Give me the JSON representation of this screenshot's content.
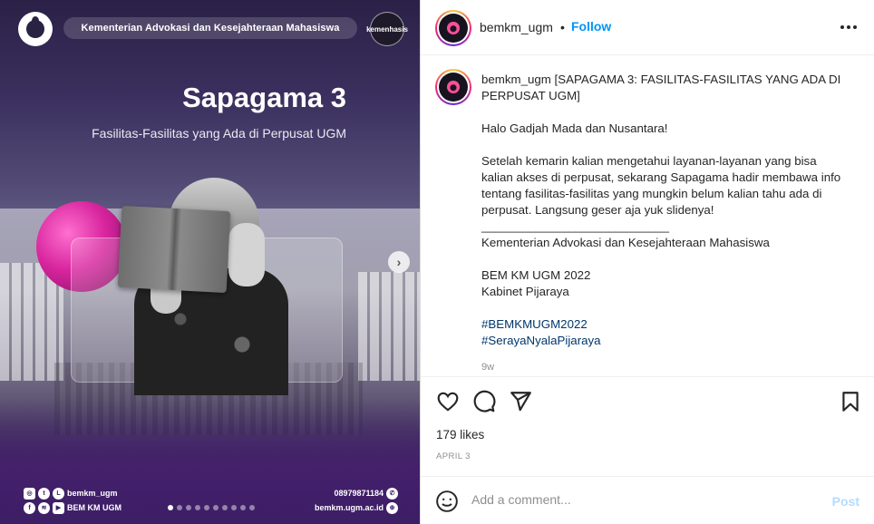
{
  "media": {
    "banner_text": "Kementerian Advokasi dan Kesejahteraan Mahasiswa",
    "right_logo_text": "kemenhasis",
    "title": "Sapagama 3",
    "subtitle": "Fasilitas-Fasilitas yang Ada di Perpusat UGM",
    "footer_left_handle": "bemkm_ugm",
    "footer_left_name": "BEM KM UGM",
    "footer_right_phone": "08979871184",
    "footer_right_site": "bemkm.ugm.ac.id",
    "carousel": {
      "total": 10,
      "active": 1
    },
    "next_icon": "chevron-right-icon"
  },
  "header": {
    "username": "bemkm_ugm",
    "separator": "•",
    "follow_label": "Follow",
    "more_icon": "more-horizontal-icon"
  },
  "caption": {
    "username": "bemkm_ugm",
    "text": " [SAPAGAMA 3: FASILITAS-FASILITAS YANG ADA DI PERPUSAT UGM]\n\nHalo Gadjah Mada dan Nusantara!\n\nSetelah kemarin kalian mengetahui layanan-layanan yang bisa kalian akses di perpusat, sekarang Sapagama hadir membawa info tentang fasilitas-fasilitas yang mungkin belum kalian tahu ada di perpusat. Langsung geser aja yuk slidenya!\n____________________________\nKementerian Advokasi dan Kesejahteraan Mahasiswa\n\nBEM KM UGM 2022\nKabinet Pijaraya\n\n",
    "hashtag1": "#BEMKMUGM2022",
    "hashtag2": "#SerayaNyalaPijaraya",
    "time_ago": "9w"
  },
  "actions": {
    "like_icon": "heart-icon",
    "comment_icon": "comment-icon",
    "share_icon": "send-icon",
    "save_icon": "bookmark-icon",
    "likes": "179 likes",
    "date": "APRIL 3"
  },
  "comment": {
    "placeholder": "Add a comment...",
    "post_label": "Post",
    "emoji_icon": "smiley-icon"
  },
  "colors": {
    "follow": "#0095f6",
    "post_disabled": "#b3dbff",
    "hashtag": "#00376b",
    "media_purple": "#3c1f66",
    "accent_pink": "#d8259e"
  }
}
